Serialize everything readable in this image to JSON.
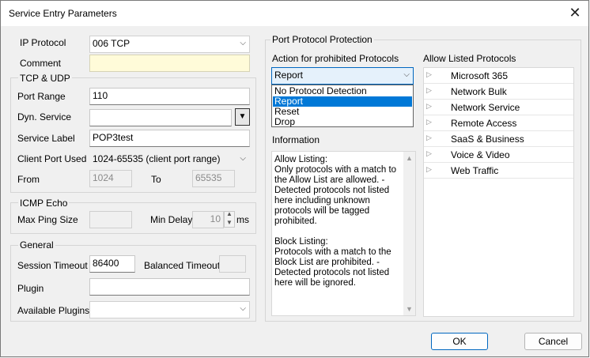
{
  "window": {
    "title": "Service Entry Parameters"
  },
  "left": {
    "ip_protocol_label": "IP Protocol",
    "ip_protocol_value": "006 TCP",
    "comment_label": "Comment",
    "comment_value": "",
    "tcp_udp": {
      "group_label": "TCP & UDP",
      "port_range_label": "Port Range",
      "port_range_value": "110",
      "dyn_service_label": "Dyn. Service",
      "dyn_service_value": "",
      "service_label_label": "Service Label",
      "service_label_value": "POP3test",
      "client_port_label": "Client Port Used",
      "client_port_value": "1024-65535 (client port range)",
      "from_label": "From",
      "from_value": "1024",
      "to_label": "To",
      "to_value": "65535"
    },
    "icmp": {
      "group_label": "ICMP Echo",
      "max_ping_label": "Max Ping Size",
      "max_ping_value": "",
      "min_delay_label": "Min Delay",
      "min_delay_value": "10",
      "min_delay_unit": "ms"
    },
    "general": {
      "group_label": "General",
      "session_timeout_label": "Session Timeout",
      "session_timeout_value": "86400",
      "balanced_timeout_label": "Balanced Timeout",
      "balanced_timeout_value": "",
      "plugin_label": "Plugin",
      "plugin_value": "",
      "available_plugins_label": "Available Plugins",
      "available_plugins_value": ""
    }
  },
  "right": {
    "group_label": "Port Protocol Protection",
    "action_label": "Action for prohibited Protocols",
    "action_value": "Report",
    "action_options": [
      "No Protocol Detection",
      "Report",
      "Reset",
      "Drop"
    ],
    "information_label": "Information",
    "information_text": "Allow Listing:\nOnly protocols with a match to the Allow List are allowed. - Detected protocols not listed here including unknown protocols will be tagged prohibited.\n\nBlock Listing:\nProtocols with a match to the Block List are prohibited. - Detected protocols not listed here will be ignored.",
    "allow_listed_label": "Allow Listed Protocols",
    "allow_listed": [
      "Microsoft 365",
      "Network Bulk",
      "Network Service",
      "Remote Access",
      "SaaS & Business",
      "Voice & Video",
      "Web Traffic"
    ]
  },
  "buttons": {
    "ok": "OK",
    "cancel": "Cancel"
  }
}
